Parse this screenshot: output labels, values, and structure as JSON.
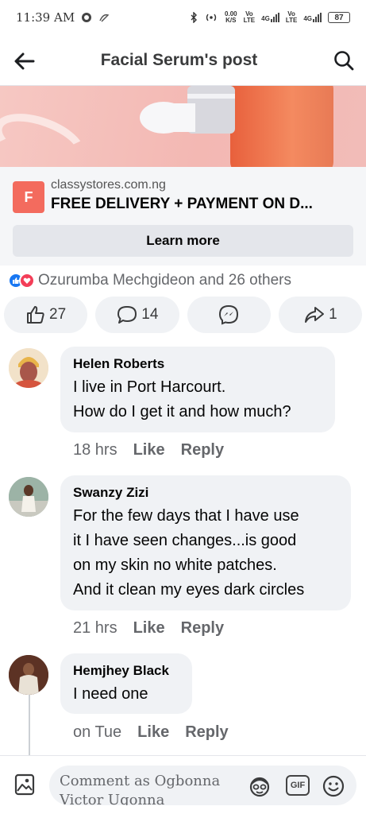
{
  "status_bar": {
    "time": "11:39 AM",
    "net_speed_top": "0.00",
    "net_speed_unit": "K/S",
    "vo_lte_1_top": "Vo",
    "vo_lte_1_bottom": "LTE",
    "network_1": "4G",
    "vo_lte_2_top": "Vo",
    "vo_lte_2_bottom": "LTE",
    "network_2": "4G",
    "battery": "87"
  },
  "header": {
    "title": "Facial Serum's post"
  },
  "ad": {
    "logo_letter": "F",
    "domain": "classystores.com.ng",
    "headline": "FREE DELIVERY + PAYMENT ON D...",
    "cta_label": "Learn more"
  },
  "reactions": {
    "summary": "Ozurumba Mechgideon and 26 others"
  },
  "actions": {
    "like_count": "27",
    "comment_count": "14",
    "share_count": "1"
  },
  "comments": [
    {
      "name": "Helen Roberts",
      "lines": [
        "I live in Port Harcourt.",
        "How do I get it and how much?"
      ],
      "time": "18 hrs",
      "like_label": "Like",
      "reply_label": "Reply"
    },
    {
      "name": "Swanzy Zizi",
      "lines": [
        "For the few days that I have use",
        "it I have seen  changes...is good",
        "on my skin no white patches.",
        "And it clean my eyes dark circles"
      ],
      "time": "21 hrs",
      "like_label": "Like",
      "reply_label": "Reply"
    },
    {
      "name": "Hemjhey Black",
      "lines": [
        "I need one"
      ],
      "time": "on Tue",
      "like_label": "Like",
      "reply_label": "Reply"
    }
  ],
  "composer": {
    "placeholder": "Comment as Ogbonna Victor Ugonna",
    "gif_label": "GIF"
  },
  "colors": {
    "facebook_blue": "#1877f2",
    "love_red": "#f33e58",
    "bubble_gray": "#f0f2f5",
    "ad_logo": "#f36b5e"
  },
  "icons": [
    "back-arrow-icon",
    "search-icon",
    "like-icon",
    "comment-icon",
    "messenger-icon",
    "share-icon",
    "photo-icon",
    "avatar-sticker-icon",
    "emoji-icon"
  ]
}
